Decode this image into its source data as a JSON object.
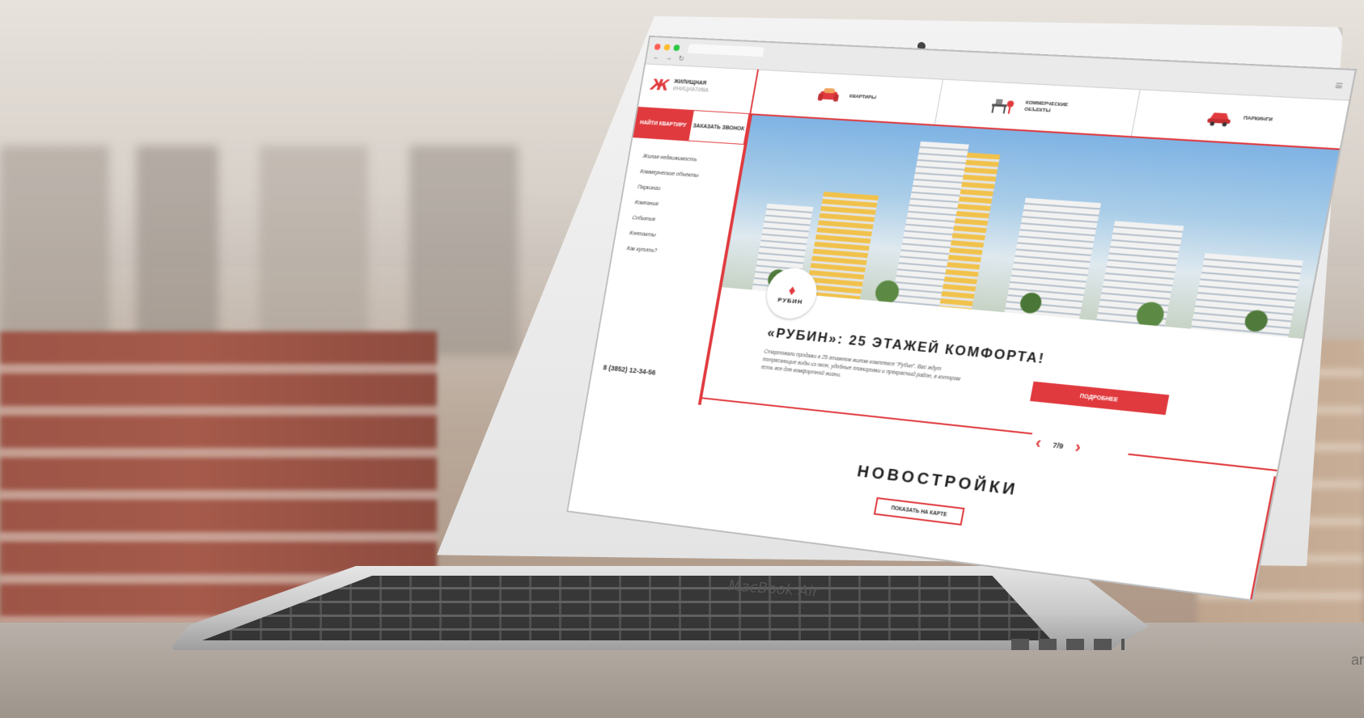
{
  "screen": {
    "logo": {
      "mark": "Ж",
      "line1": "ЖИЛИЩНАЯ",
      "line2": "ИНИЦИАТИВА"
    },
    "sidebar": {
      "find_button": "НАЙТИ КВАРТИРУ",
      "call_button": "ЗАКАЗАТЬ ЗВОНОК",
      "menu": [
        "Жилая недвижимость",
        "Коммерческие объекты",
        "Паркинги",
        "Компания",
        "События",
        "Контакты",
        "Как купить?"
      ],
      "phone": "8 (3852) 12-34-56"
    },
    "topnav": [
      {
        "label": "КВАРТИРЫ",
        "icon": "armchair-icon"
      },
      {
        "label": "КОММЕРЧЕСКИЕ ОБЪЕКТЫ",
        "icon": "office-desk-icon"
      },
      {
        "label": "ПАРКИНГИ",
        "icon": "car-icon"
      }
    ],
    "hero": {
      "badge": "РУБИН",
      "title": "«РУБИН»: 25 ЭТАЖЕЙ КОМФОРТА!",
      "description": "Стартовали продажи в 25-этажном жилом комплексе \"Рубин\". Вас ждут потрясающие виды из окон, удобные планировки и прекрасный район, в котором есть все для комфортной жизни.",
      "more_button": "ПОДРОБНЕЕ"
    },
    "pager": {
      "text": "7/9"
    },
    "section": {
      "title": "НОВОСТРОЙКИ",
      "map_button": "ПОКАЗАТЬ НА КАРТЕ"
    }
  },
  "device": {
    "brand": "MacBook Air"
  },
  "watermark": "ar",
  "colors": {
    "accent": "#e03a3e",
    "text": "#222222"
  }
}
